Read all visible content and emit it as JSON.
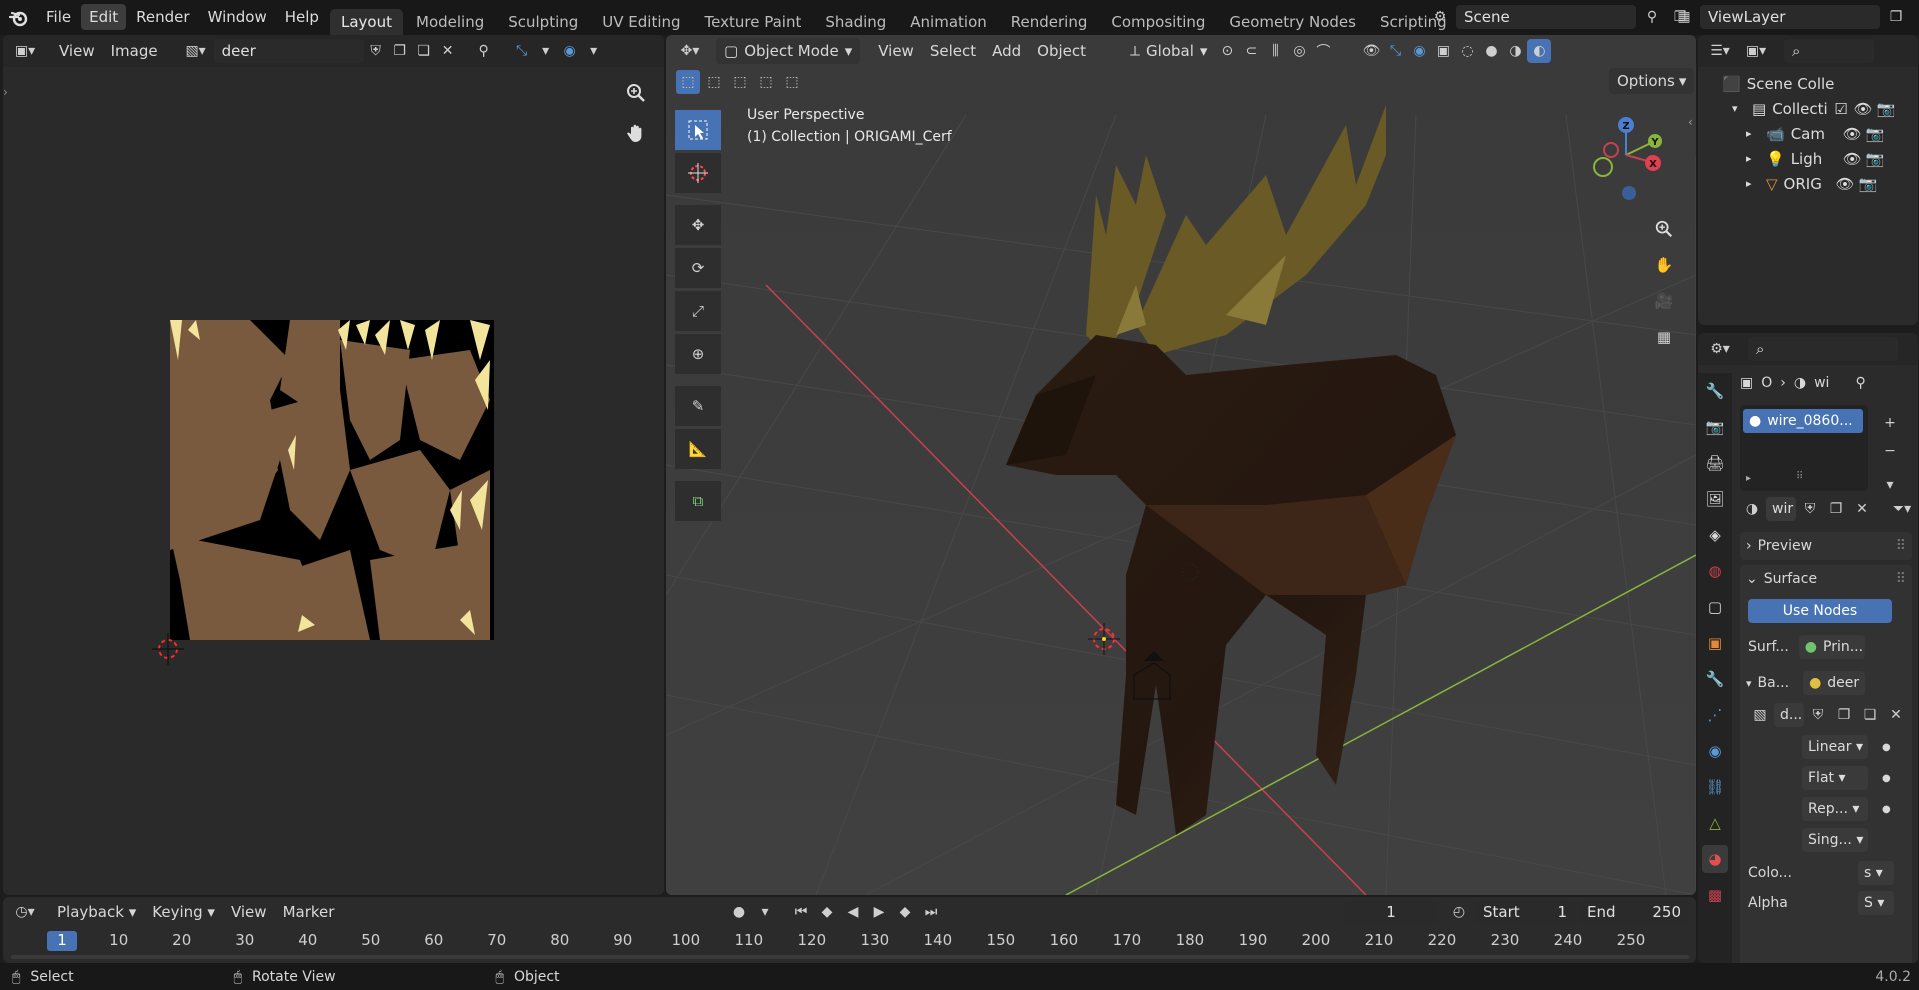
{
  "app": {
    "version": "4.0.2"
  },
  "menubar": {
    "items": [
      "File",
      "Edit",
      "Render",
      "Window",
      "Help"
    ],
    "workspaces": [
      "Layout",
      "Modeling",
      "Sculpting",
      "UV Editing",
      "Texture Paint",
      "Shading",
      "Animation",
      "Rendering",
      "Compositing",
      "Geometry Nodes",
      "Scripting"
    ],
    "add_workspace": "+",
    "scene": "Scene",
    "view_layer": "ViewLayer"
  },
  "image_editor": {
    "view_label": "View",
    "image_label": "Image",
    "image_name": "deer"
  },
  "viewport": {
    "mode": "Object Mode",
    "menus": [
      "View",
      "Select",
      "Add",
      "Object"
    ],
    "transform_orientation": "Global",
    "perspective": "User Perspective",
    "collection_info": "(1) Collection | ORIGAMI_Cerf",
    "options_label": "Options",
    "gizmo": {
      "z": "Z",
      "y": "Y",
      "x": "X"
    }
  },
  "outliner": {
    "root": "Scene Colle",
    "rows": [
      {
        "name": "Collectio"
      },
      {
        "name": "Cam"
      },
      {
        "name": "Ligh"
      },
      {
        "name": "ORIG"
      }
    ]
  },
  "properties": {
    "tab_o": "O",
    "tab_wi": "wi",
    "material_slot": "wire_0860...",
    "material_name": "wir",
    "preview": "Preview",
    "surface": "Surface",
    "use_nodes": "Use Nodes",
    "surface_label": "Surf...",
    "surface_value": "Prin...",
    "base_label": "Ba...",
    "base_value": "deer",
    "image_field": "d...",
    "interp": "Linear",
    "projection": "Flat",
    "extension": "Rep...",
    "source": "Sing...",
    "color_label": "Colo...",
    "color_value": "s",
    "alpha_label": "Alpha",
    "alpha_value": "S"
  },
  "timeline": {
    "menus": [
      "Playback",
      "Keying",
      "View",
      "Marker"
    ],
    "current_frame": "1",
    "start_label": "Start",
    "start_value": "1",
    "end_label": "End",
    "end_value": "250",
    "ticks": [
      "1",
      "10",
      "20",
      "30",
      "40",
      "50",
      "60",
      "70",
      "80",
      "90",
      "100",
      "110",
      "120",
      "130",
      "140",
      "150",
      "160",
      "170",
      "180",
      "190",
      "200",
      "210",
      "220",
      "230",
      "240",
      "250"
    ]
  },
  "statusbar": {
    "select": "Select",
    "rotate_view": "Rotate View",
    "object": "Object",
    "version": "4.0.2"
  },
  "colors": {
    "accent": "#4772b3",
    "deer_body": "#2a1b10",
    "antlers": "#7a6a2e",
    "uv_fill": "#7a5a3e",
    "x_axis": "#c94050",
    "y_axis": "#8ab43a"
  }
}
